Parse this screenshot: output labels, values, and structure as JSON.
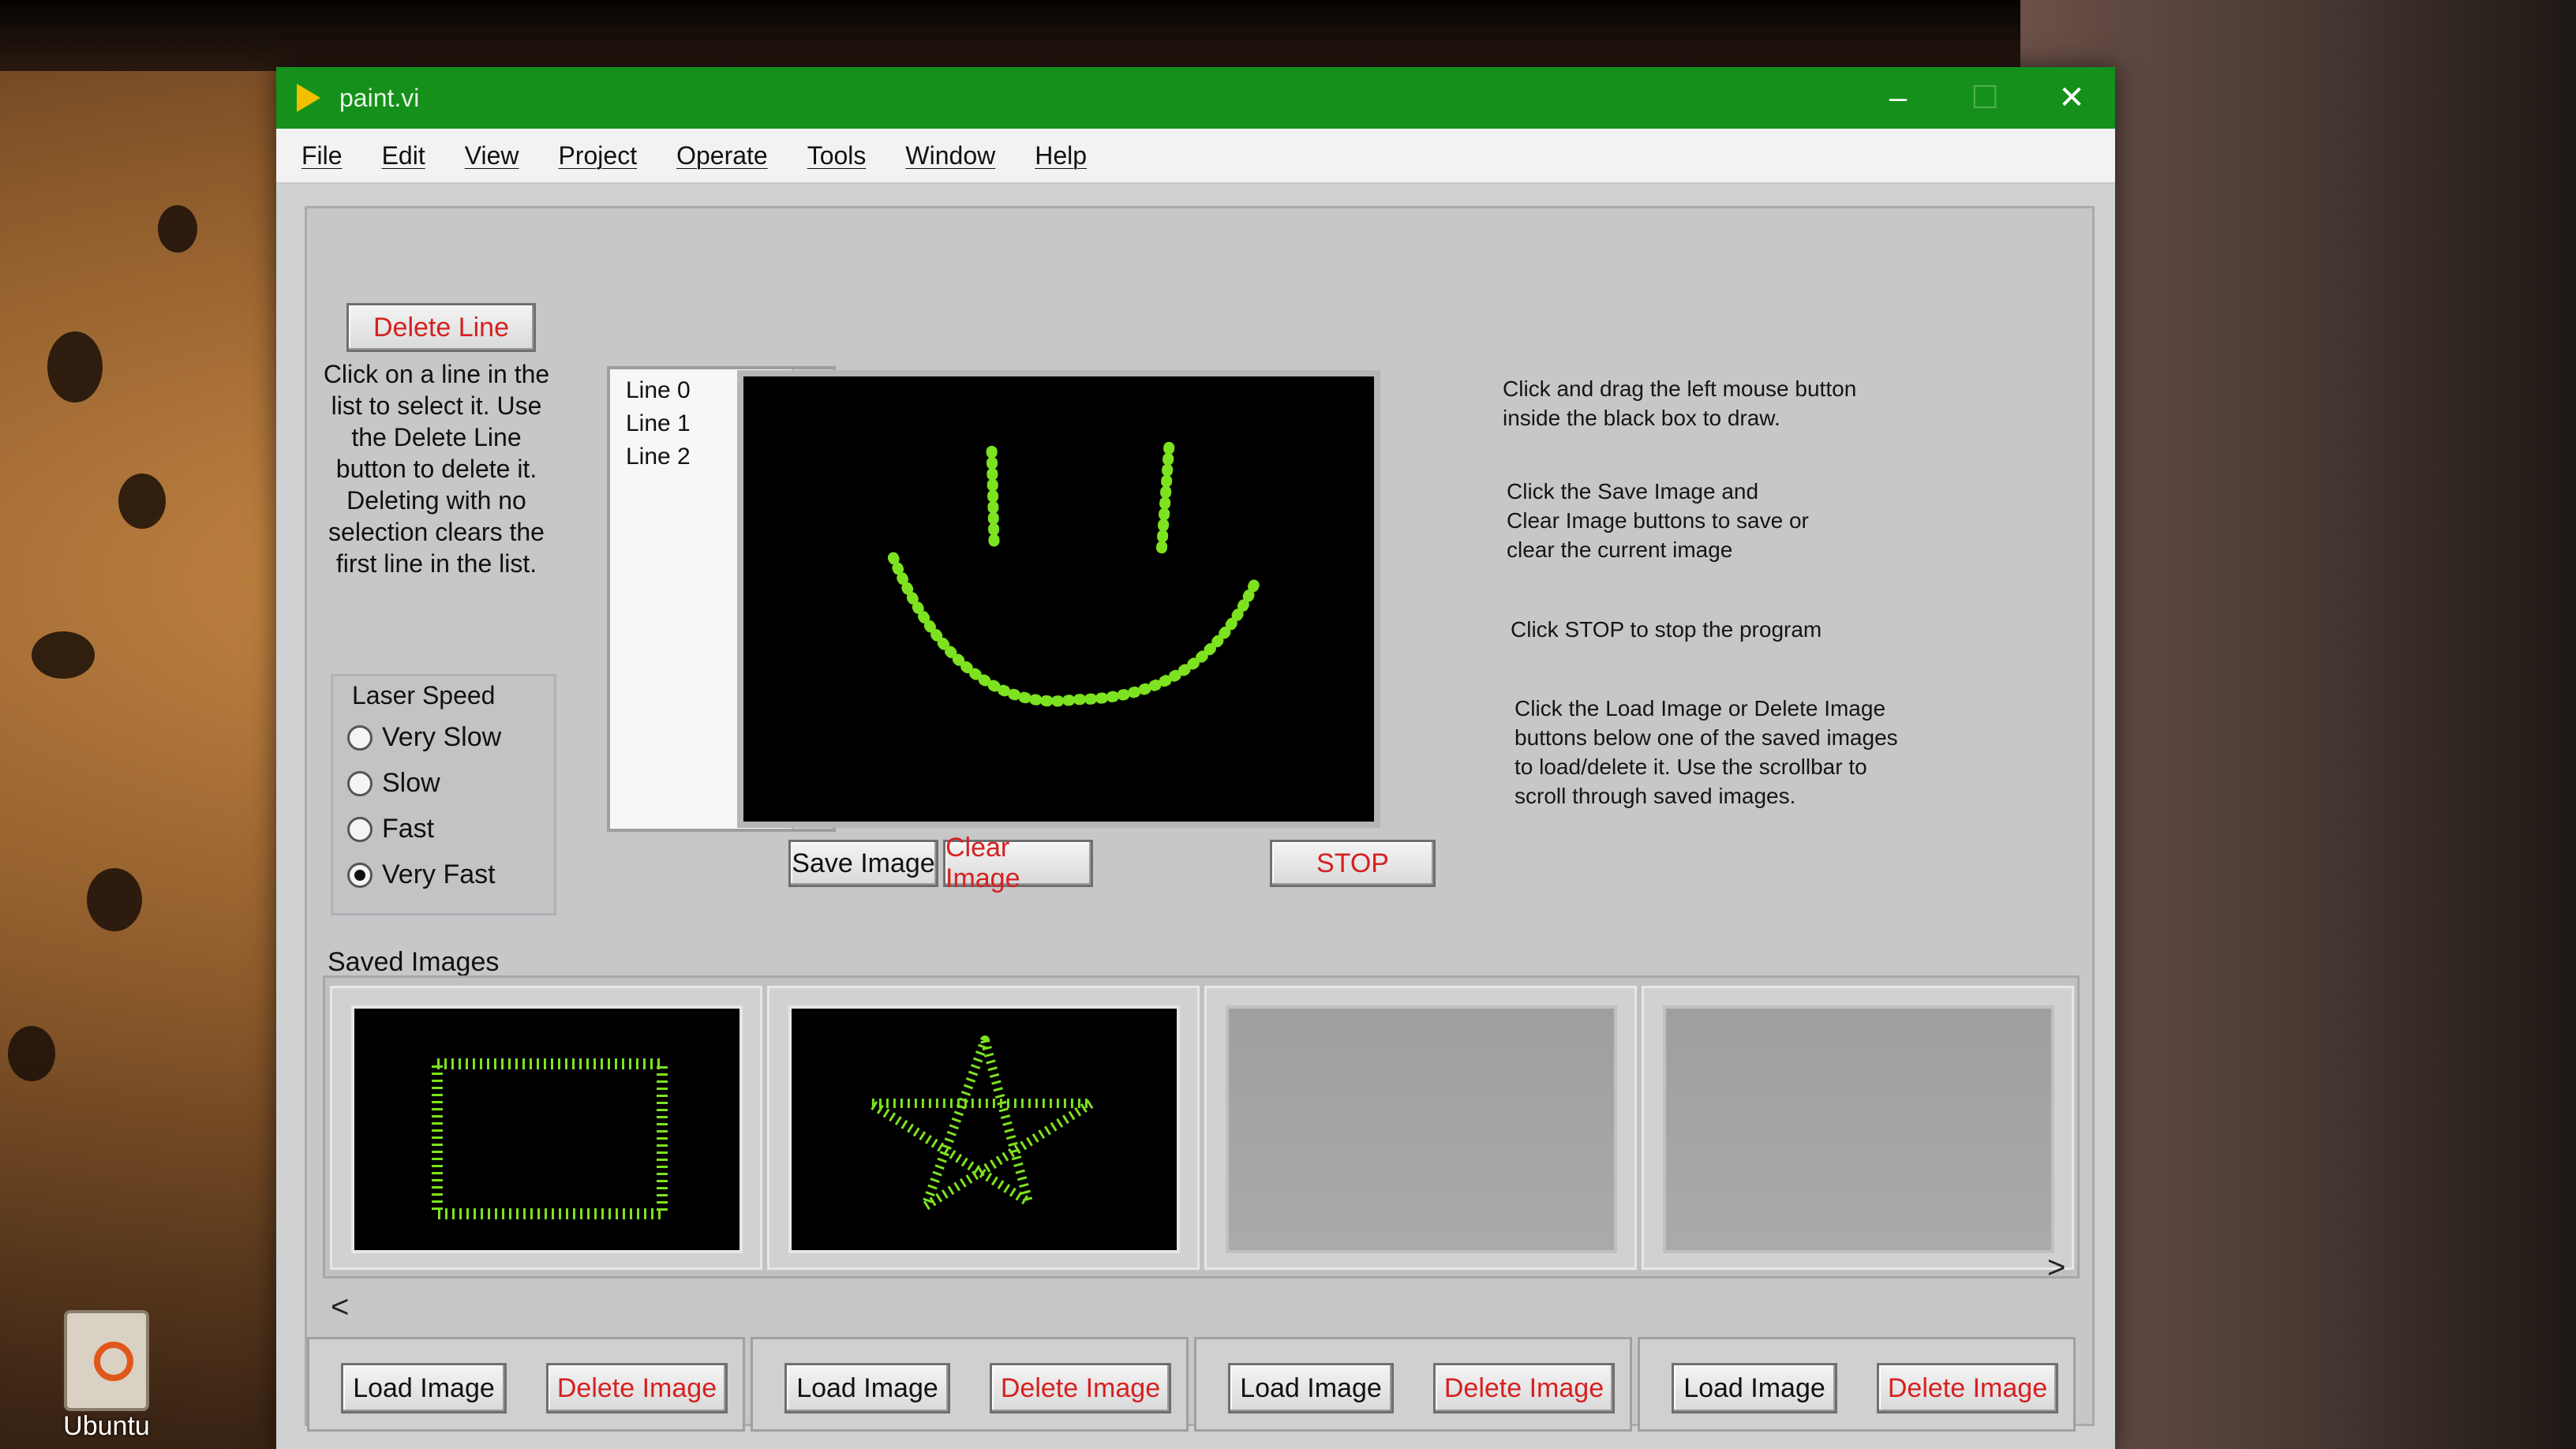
{
  "window": {
    "title": "paint.vi",
    "controls": {
      "minimize": "–",
      "maximize": "☐",
      "close": "✕"
    }
  },
  "menu": [
    "File",
    "Edit",
    "View",
    "Project",
    "Operate",
    "Tools",
    "Window",
    "Help"
  ],
  "left_panel": {
    "delete_line_label": "Delete Line",
    "help_text": "Click on a line in the list to select it. Use the Delete Line button to delete it. Deleting with no selection clears the first line in the list."
  },
  "laser_speed": {
    "title": "Laser Speed",
    "options": [
      "Very Slow",
      "Slow",
      "Fast",
      "Very Fast"
    ],
    "selected": "Very Fast"
  },
  "line_list": {
    "items": [
      "Line 0",
      "Line 1",
      "Line 2"
    ],
    "scroll_up_icon": "triangle-up",
    "scroll_down_icon": "triangle-down"
  },
  "canvas": {
    "background": "#000000",
    "stroke_color": "#7de21f",
    "drawing": "smiley-face"
  },
  "canvas_buttons": {
    "save_label": "Save Image",
    "clear_label": "Clear Image",
    "stop_label": "STOP"
  },
  "instructions": {
    "p1": "Click and drag the left mouse button\ninside the black box to draw.",
    "p2": "Click the Save Image and\nClear Image buttons to save or\nclear the current image",
    "p3": "Click STOP to stop the program",
    "p4": "Click the Load Image or Delete Image\nbuttons below one of the saved images\nto load/delete it. Use the scrollbar to\nscroll through saved images."
  },
  "saved_images": {
    "label": "Saved Images",
    "slots": [
      {
        "content": "rectangle",
        "load_label": "Load Image",
        "delete_label": "Delete Image"
      },
      {
        "content": "star",
        "load_label": "Load Image",
        "delete_label": "Delete Image"
      },
      {
        "content": "empty",
        "load_label": "Load Image",
        "delete_label": "Delete Image"
      },
      {
        "content": "empty",
        "load_label": "Load Image",
        "delete_label": "Delete Image"
      }
    ],
    "scroll_left_icon": "<",
    "scroll_right_icon": ">"
  },
  "desktop": {
    "icon_label": "Ubuntu"
  },
  "colors": {
    "titlebar": "#15901a",
    "accent_red_text": "#d62020",
    "drawing_green": "#7de21f"
  }
}
